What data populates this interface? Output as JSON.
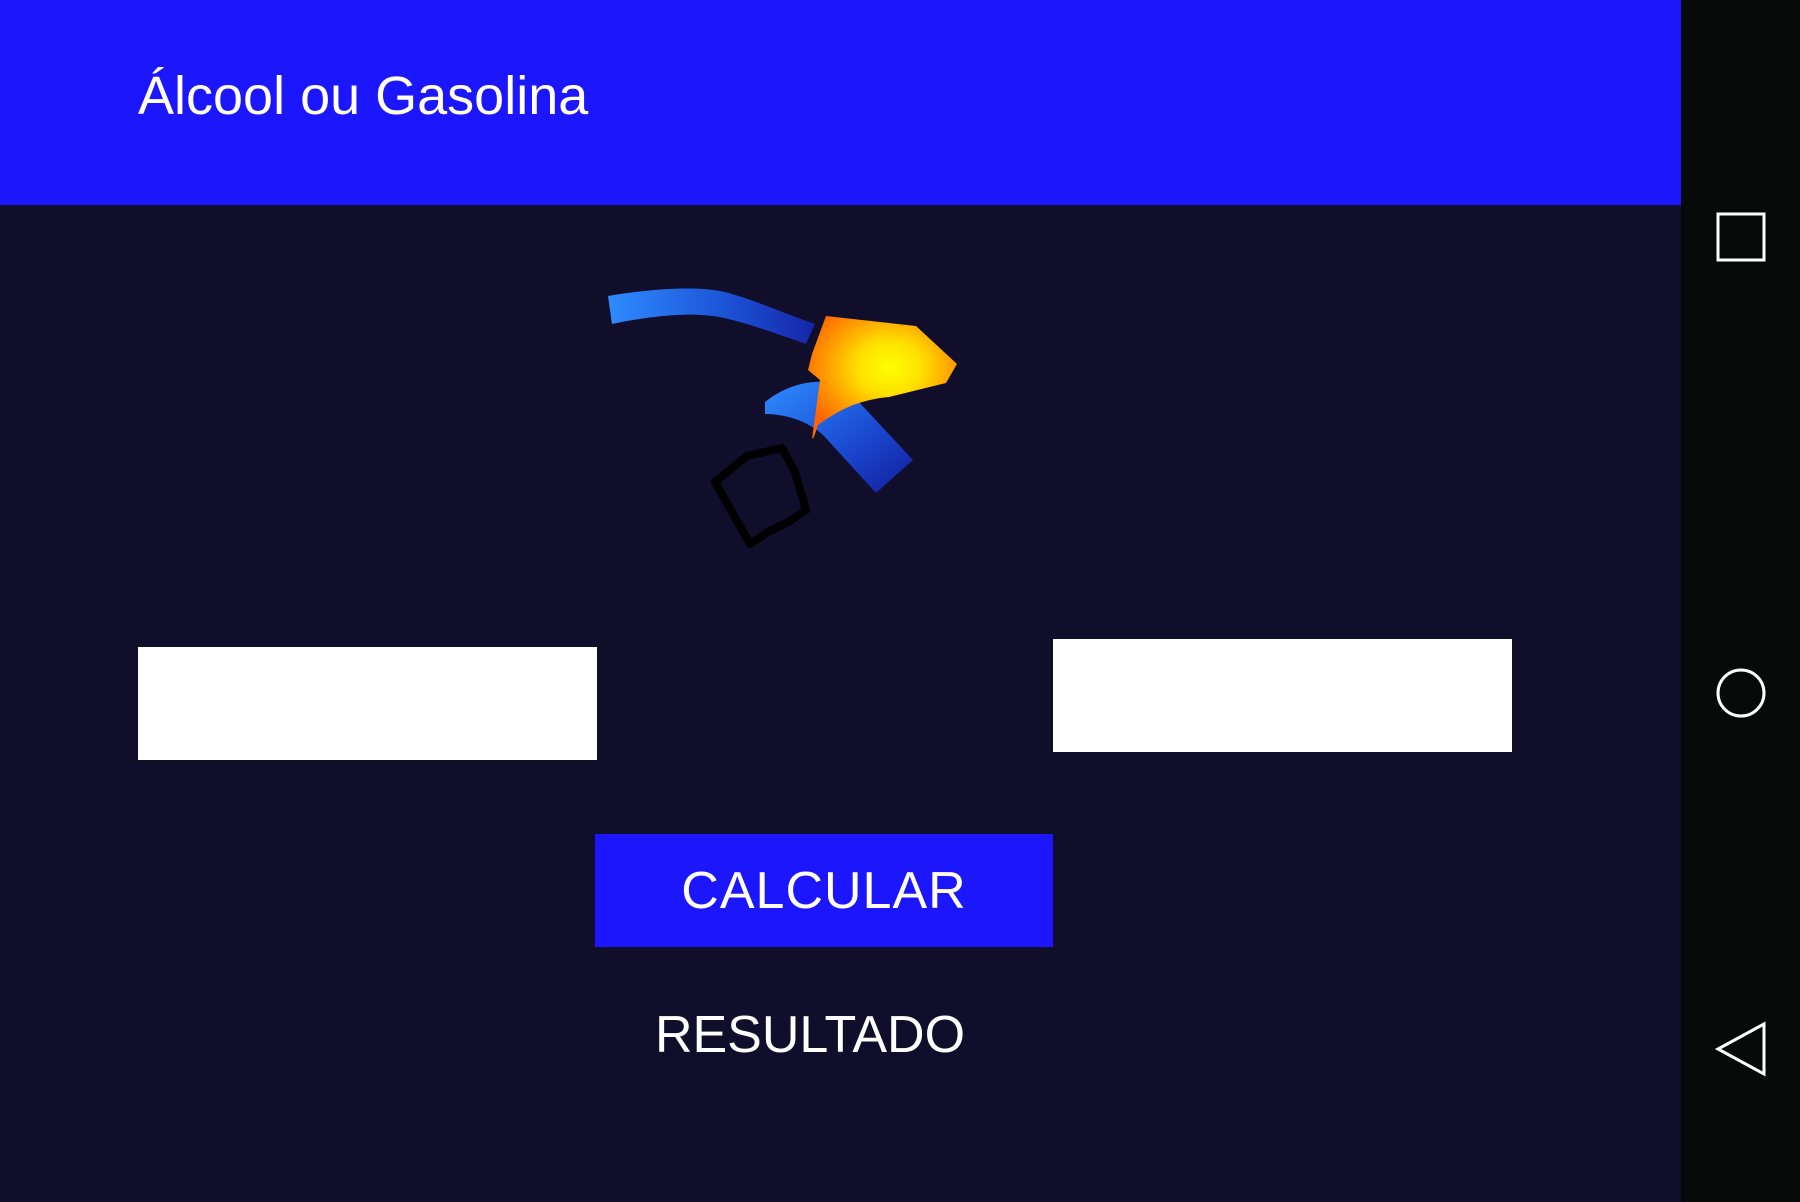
{
  "app_bar": {
    "title": "Álcool ou Gasolina",
    "color": "#1b16fb"
  },
  "main": {
    "image_icon": "fuel-pump-nozzle-icon",
    "inputs": [
      {
        "name": "alcohol-price",
        "value": "",
        "placeholder": ""
      },
      {
        "name": "gasoline-price",
        "value": "",
        "placeholder": ""
      }
    ],
    "calculate_label": "CALCULAR",
    "result_label": "RESULTADO",
    "background": "#100e2a"
  },
  "nav_bar": {
    "icons": [
      "square-icon",
      "circle-icon",
      "triangle-back-icon"
    ],
    "background": "#080a0a"
  }
}
